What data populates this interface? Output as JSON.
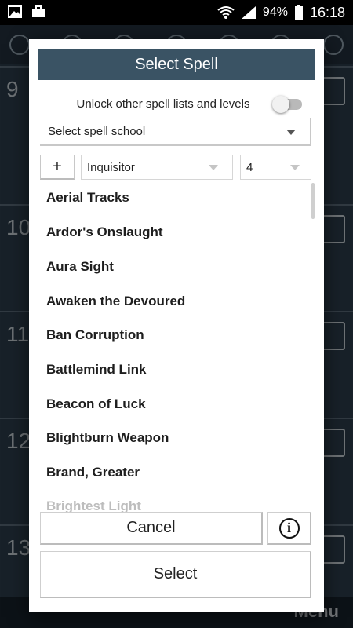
{
  "status_bar": {
    "battery_percent": "94%",
    "time": "16:18"
  },
  "background": {
    "row_numbers": [
      "9",
      "10",
      "11",
      "12",
      "13"
    ],
    "menu_label": "Menu"
  },
  "dialog": {
    "title": "Select Spell",
    "unlock_label": "Unlock other spell lists and levels",
    "unlock_enabled": false,
    "school_placeholder": "Select spell school",
    "add_label": "+",
    "class_value": "Inquisitor",
    "level_value": "4",
    "spells": [
      "Aerial Tracks",
      "Ardor's Onslaught",
      "Aura Sight",
      "Awaken the Devoured",
      "Ban Corruption",
      "Battlemind Link",
      "Beacon of Luck",
      "Blightburn Weapon",
      "Brand, Greater",
      "Brightest Light"
    ],
    "cancel_label": "Cancel",
    "info_glyph": "i",
    "select_label": "Select"
  }
}
